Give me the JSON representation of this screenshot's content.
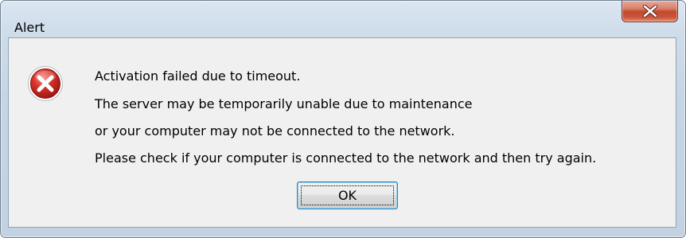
{
  "window": {
    "title": "Alert"
  },
  "icons": {
    "close": "close-icon",
    "error": "error-icon"
  },
  "message": {
    "lines": [
      "Activation failed due to timeout.",
      "The server may be temporarily unable due to maintenance",
      "or your computer may not be connected to the network.",
      "Please check if your computer is connected to the network and then try again."
    ]
  },
  "buttons": {
    "ok_label": "OK"
  },
  "colors": {
    "close_button": "#c24a2d",
    "error_icon": "#d22f2f",
    "ok_focus_border": "#3c7fb1"
  }
}
